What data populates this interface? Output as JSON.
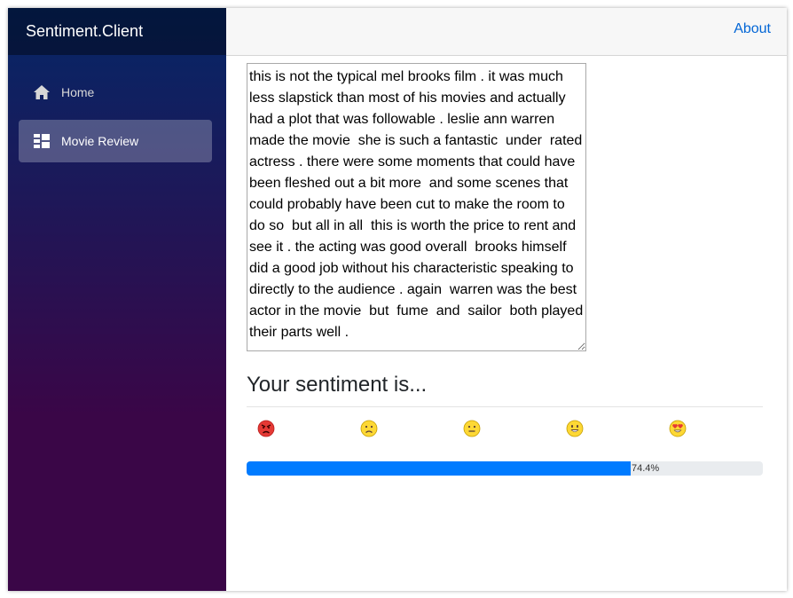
{
  "app": {
    "brand": "Sentiment.Client"
  },
  "sidebar": {
    "items": [
      {
        "label": "Home",
        "icon": "home-icon",
        "active": false
      },
      {
        "label": "Movie Review",
        "icon": "list-icon",
        "active": true
      }
    ]
  },
  "topbar": {
    "about_label": "About"
  },
  "review": {
    "text": "this is not the typical mel brooks film . it was much less slapstick than most of his movies and actually had a plot that was followable . leslie ann warren made the movie  she is such a fantastic  under  rated actress . there were some moments that could have been fleshed out a bit more  and some scenes that could probably have been cut to make the room to do so  but all in all  this is worth the price to rent and see it . the acting was good overall  brooks himself did a good job without his characteristic speaking to directly to the audience . again  warren was the best actor in the movie  but  fume  and  sailor  both played their parts well ."
  },
  "sentiment": {
    "heading": "Your sentiment is...",
    "emojis": [
      "angry-face-icon",
      "frowning-face-icon",
      "neutral-face-icon",
      "grinning-face-icon",
      "heart-eyes-face-icon"
    ],
    "progress_value": 0.744,
    "progress_label": "74.4%"
  },
  "colors": {
    "accent": "#007bff",
    "link": "#0366d6",
    "sidebar_top": "#052767",
    "sidebar_bottom": "#3a0647"
  }
}
